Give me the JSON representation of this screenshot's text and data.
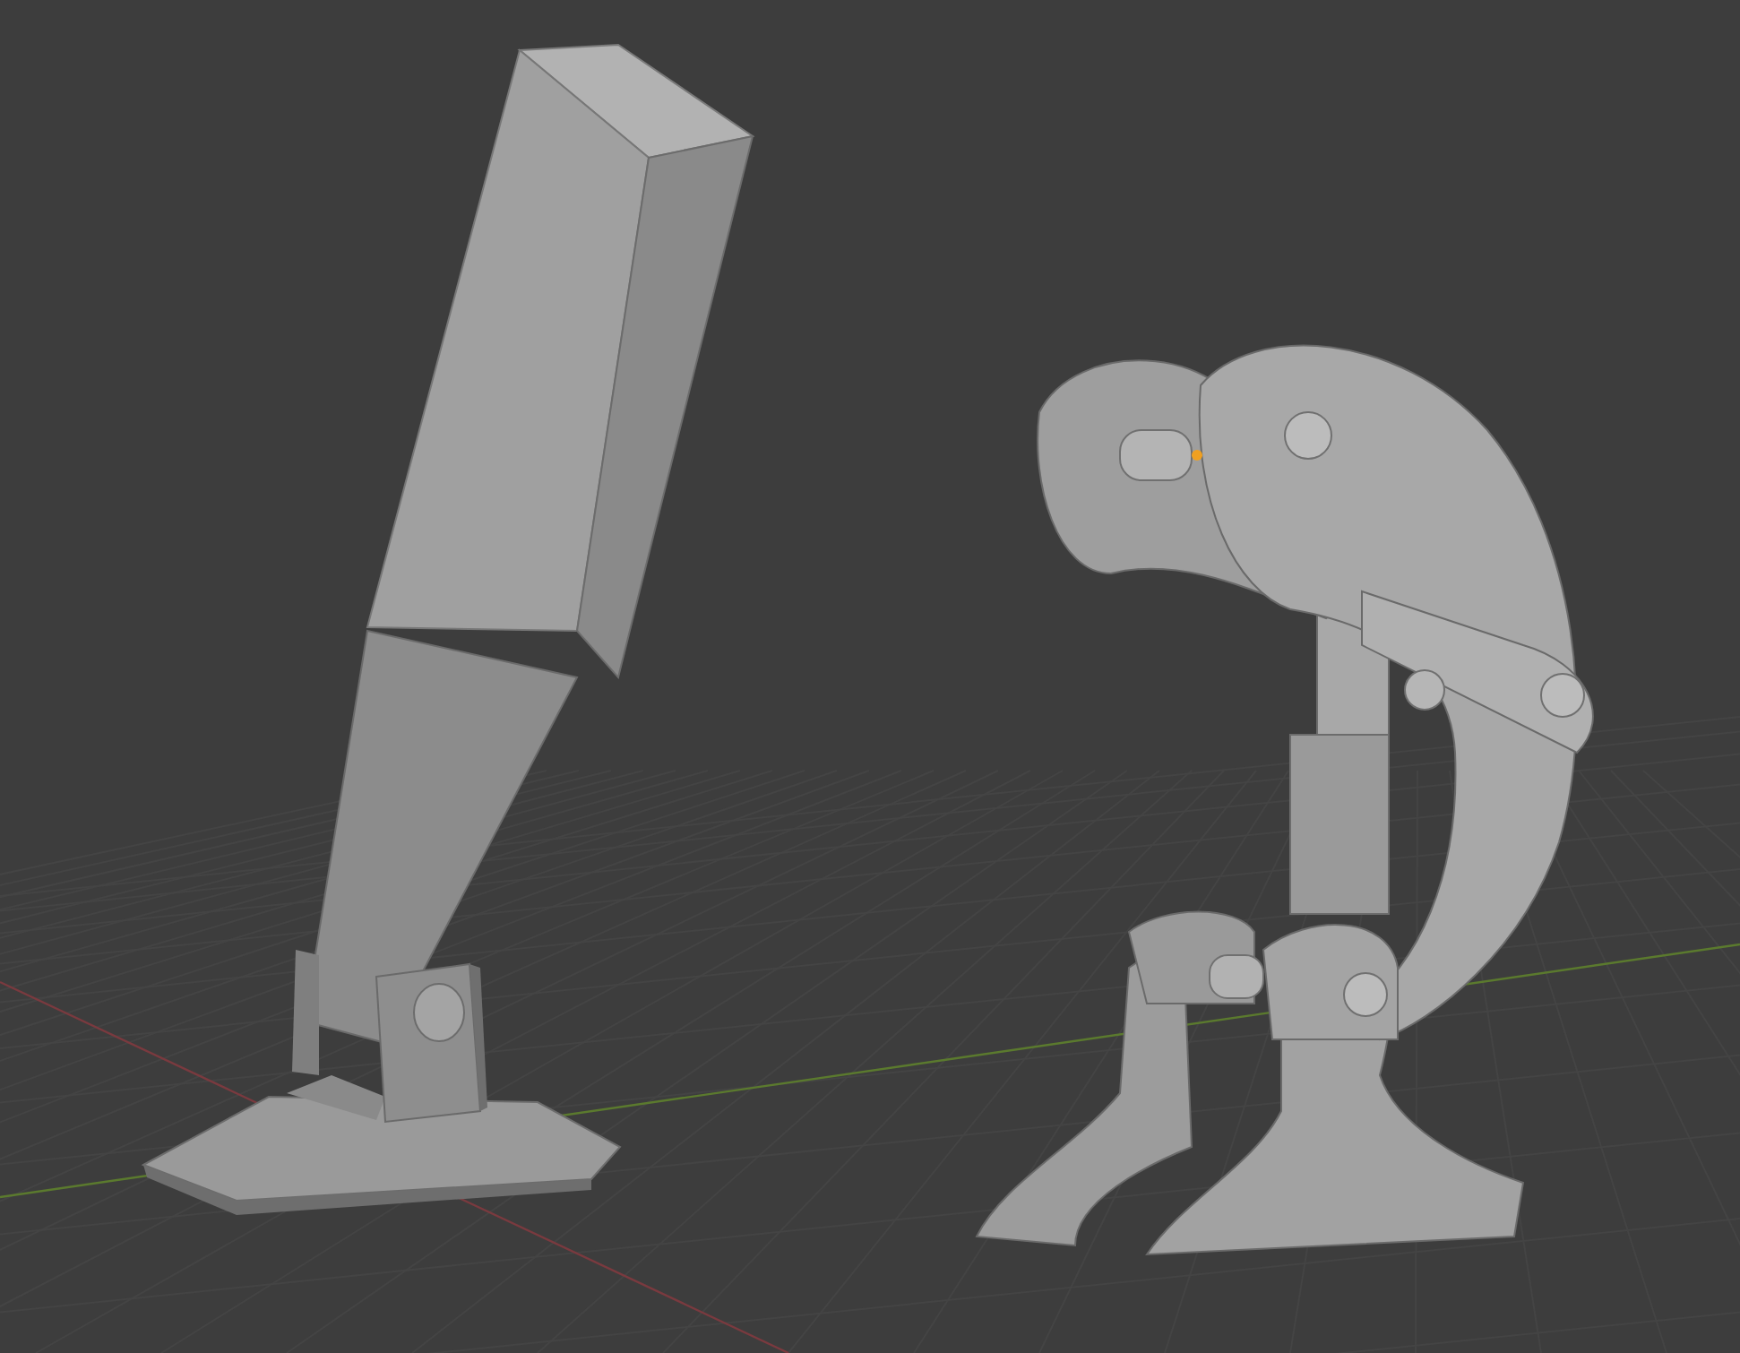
{
  "viewport": {
    "show_floor_grid": true,
    "show_axes": true
  }
}
